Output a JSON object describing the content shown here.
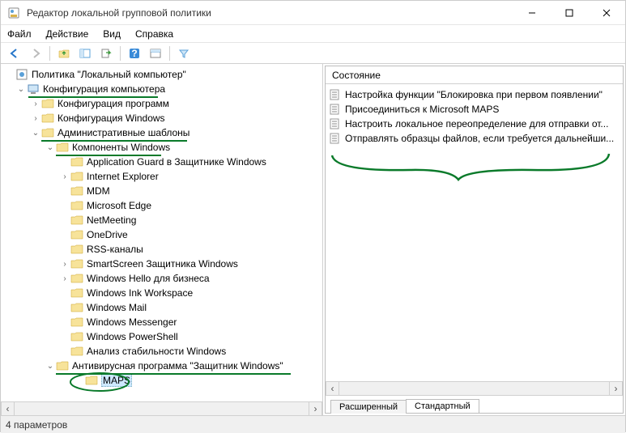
{
  "window": {
    "title": "Редактор локальной групповой политики"
  },
  "menu": {
    "file": "Файл",
    "action": "Действие",
    "view": "Вид",
    "help": "Справка"
  },
  "tree": {
    "root": "Политика \"Локальный компьютер\"",
    "computer_config": "Конфигурация компьютера",
    "program_config": "Конфигурация программ",
    "windows_config": "Конфигурация Windows",
    "admin_templates": "Административные шаблоны",
    "win_components": "Компоненты Windows",
    "items": {
      "app_guard": "Application Guard в Защитнике Windows",
      "ie": "Internet Explorer",
      "mdm": "MDM",
      "edge": "Microsoft Edge",
      "netmeeting": "NetMeeting",
      "onedrive": "OneDrive",
      "rss": "RSS-каналы",
      "smartscreen": "SmartScreen Защитника Windows",
      "hello": "Windows Hello для бизнеса",
      "ink": "Windows Ink Workspace",
      "mail": "Windows Mail",
      "messenger": "Windows Messenger",
      "powershell": "Windows PowerShell",
      "stability": "Анализ стабильности Windows",
      "defender_av": "Антивирусная программа \"Защитник Windows\"",
      "maps": "MAPS"
    }
  },
  "right": {
    "header": "Состояние",
    "items": {
      "block_first": "Настройка функции \"Блокировка при первом появлении\"",
      "join_maps": "Присоединиться к Microsoft MAPS",
      "local_override": "Настроить локальное переопределение для отправки от...",
      "send_samples": "Отправлять образцы файлов, если требуется дальнейши..."
    },
    "tabs": {
      "extended": "Расширенный",
      "standard": "Стандартный"
    }
  },
  "status": {
    "text": "4 параметров"
  }
}
